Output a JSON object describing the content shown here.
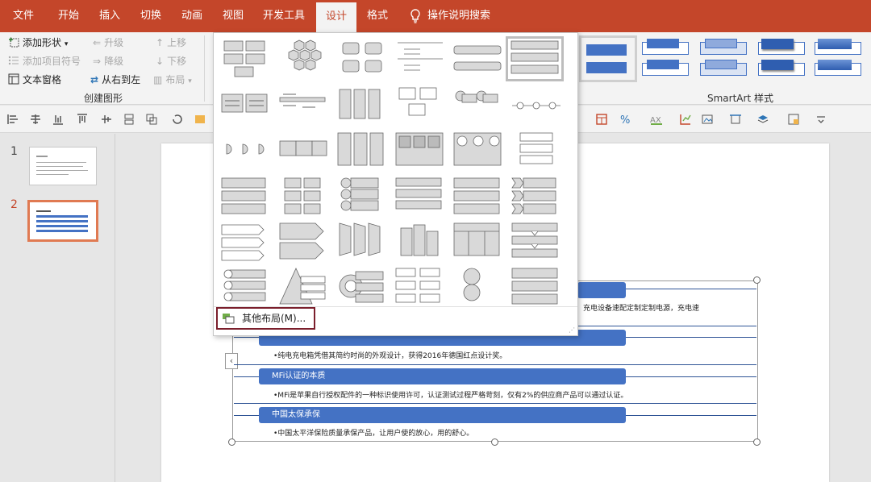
{
  "tabs": [
    {
      "label": "文件"
    },
    {
      "label": "开始"
    },
    {
      "label": "插入"
    },
    {
      "label": "切换"
    },
    {
      "label": "动画"
    },
    {
      "label": "视图"
    },
    {
      "label": "开发工具"
    },
    {
      "label": "设计"
    },
    {
      "label": "格式"
    }
  ],
  "tell_me": "操作说明搜索",
  "create_group": {
    "add_shape": "添加形状",
    "add_bullet": "添加项目符号",
    "text_pane": "文本窗格",
    "promote": "升级",
    "demote": "降级",
    "rtl": "从右到左",
    "move_up": "上移",
    "move_down": "下移",
    "layout": "布局",
    "label": "创建图形"
  },
  "styles_group": {
    "label": "SmartArt 样式"
  },
  "slides": [
    {
      "num": "1"
    },
    {
      "num": "2"
    }
  ],
  "gallery": {
    "more_layouts": "其他布局(M)..."
  },
  "smartart": {
    "rows": [
      {
        "title": "",
        "text": "）充电设备速配定制定制电源，充电速"
      },
      {
        "title": "",
        "text": "•纯电充电箱凭借其简约时尚的外观设计，获得2016年德国红点设计奖。"
      },
      {
        "title": "MFi认证的本质",
        "text": "•MFi是苹果自行授权配件的一种标识使用许可，认证测试过程严格苛刻，仅有2%的供应商产品可以通过认证。"
      },
      {
        "title": "中国太保承保",
        "text": "•中国太平洋保险质量承保产品，让用户使的放心，用的舒心。"
      }
    ]
  },
  "colors": {
    "accent": "#c4462a",
    "smartart_blue": "#4472c4",
    "highlight_border": "#7b1f2c"
  }
}
